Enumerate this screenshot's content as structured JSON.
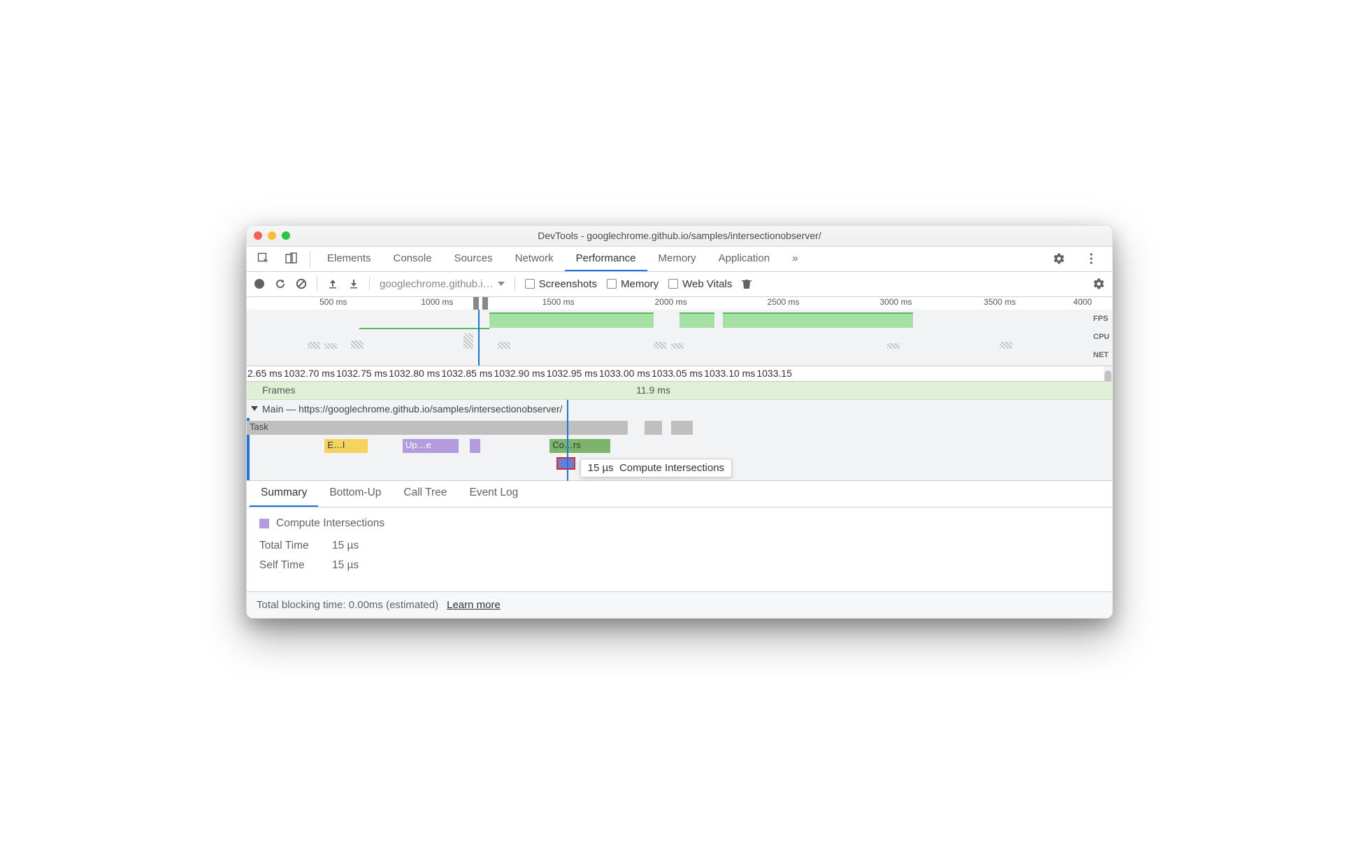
{
  "window": {
    "title": "DevTools - googlechrome.github.io/samples/intersectionobserver/"
  },
  "tabs": {
    "items": [
      "Elements",
      "Console",
      "Sources",
      "Network",
      "Performance",
      "Memory",
      "Application"
    ],
    "active": "Performance",
    "overflow_glyph": "»"
  },
  "toolbar": {
    "profile_select": "googlechrome.github.i…",
    "chk_screenshots": "Screenshots",
    "chk_memory": "Memory",
    "chk_webvitals": "Web Vitals"
  },
  "overview": {
    "ticks": [
      "500 ms",
      "1000 ms",
      "1500 ms",
      "2000 ms",
      "2500 ms",
      "3000 ms",
      "3500 ms",
      "4000 ms"
    ],
    "lanes": [
      "FPS",
      "CPU",
      "NET"
    ]
  },
  "detail_ruler": [
    "2.65 ms",
    "1032.70 ms",
    "1032.75 ms",
    "1032.80 ms",
    "1032.85 ms",
    "1032.90 ms",
    "1032.95 ms",
    "1033.00 ms",
    "1033.05 ms",
    "1033.10 ms",
    "1033.15"
  ],
  "frames": {
    "label": "Frames",
    "duration": "11.9 ms"
  },
  "main": {
    "header": "Main — https://googlechrome.github.io/samples/intersectionobserver/",
    "task_label": "Task",
    "events": {
      "e0": "E…l",
      "e1": "Up…e",
      "e2": "Co…rs"
    }
  },
  "tooltip": {
    "time": "15 µs",
    "name": "Compute Intersections"
  },
  "bottom_tabs": {
    "items": [
      "Summary",
      "Bottom-Up",
      "Call Tree",
      "Event Log"
    ],
    "active": "Summary"
  },
  "summary": {
    "title": "Compute Intersections",
    "total_label": "Total Time",
    "total_value": "15 µs",
    "self_label": "Self Time",
    "self_value": "15 µs"
  },
  "footer": {
    "text": "Total blocking time: 0.00ms (estimated)",
    "link": "Learn more"
  }
}
